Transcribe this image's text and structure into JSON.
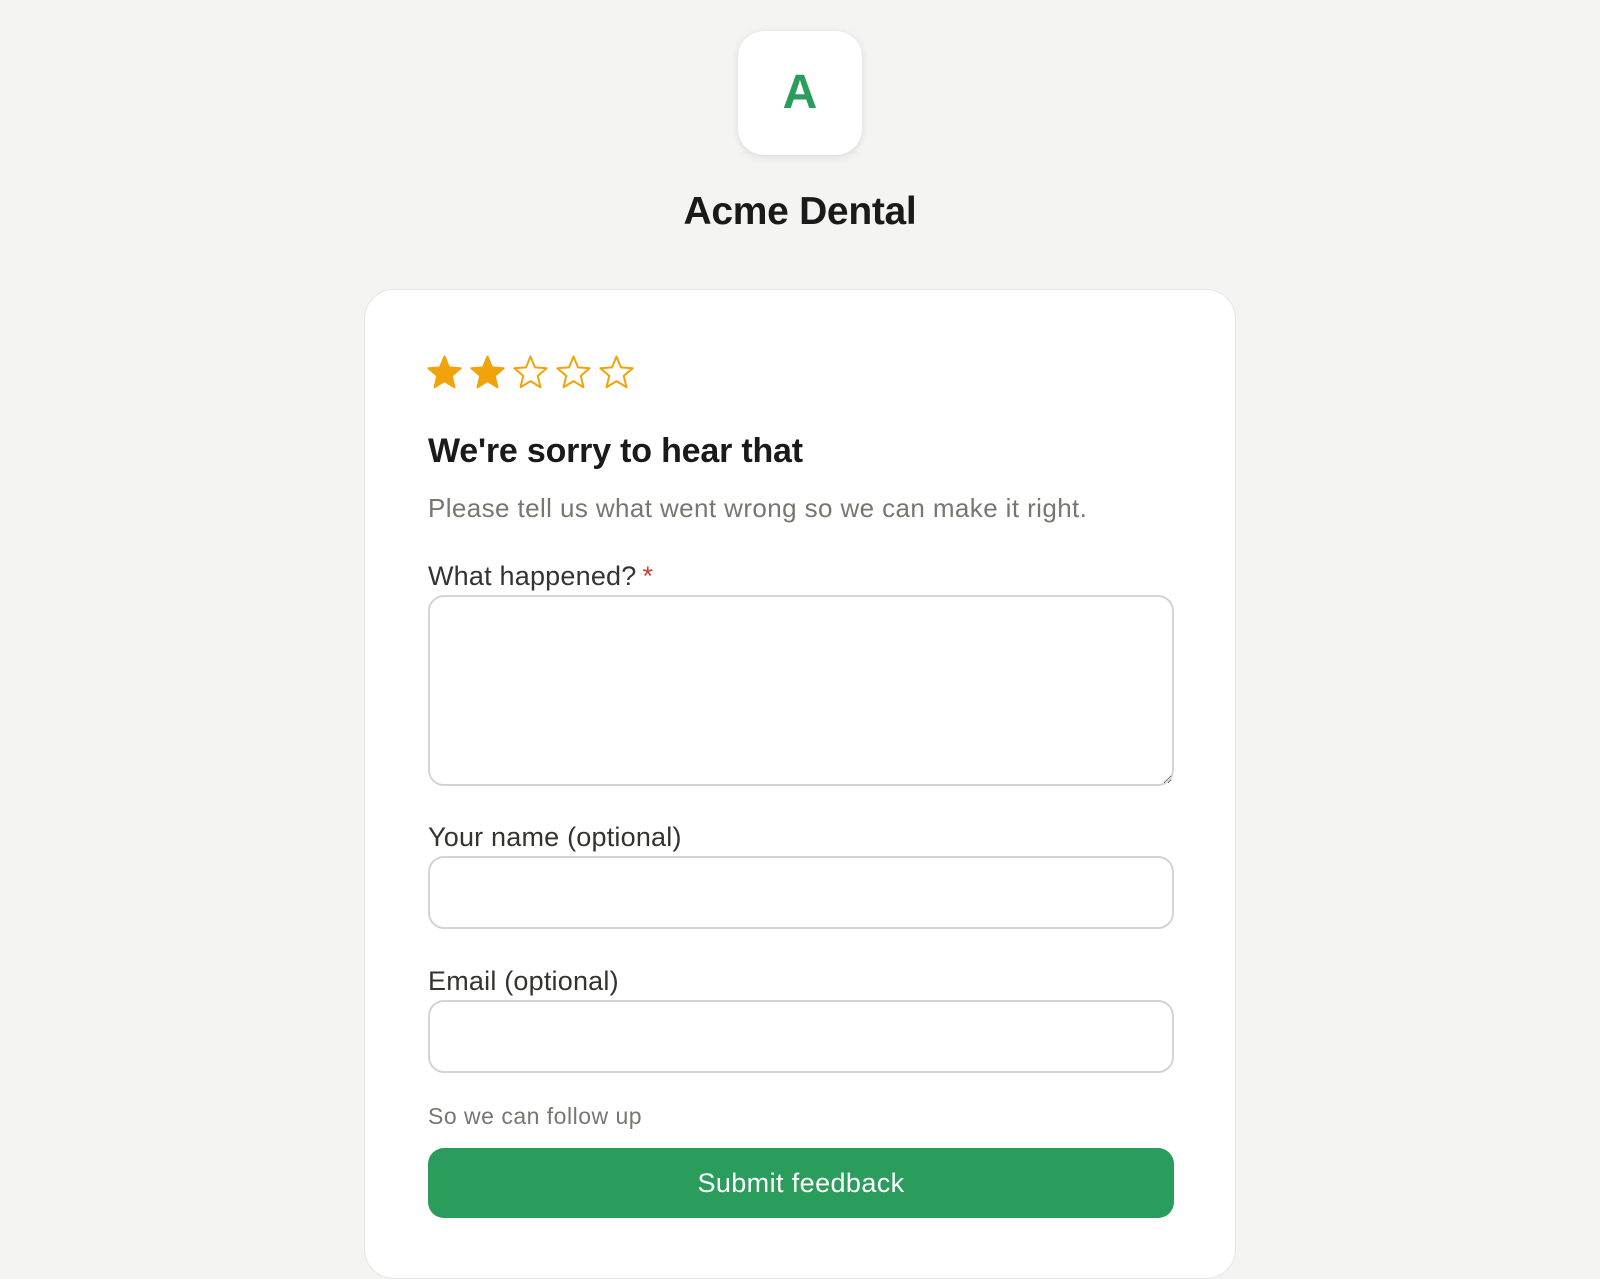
{
  "brand": {
    "logo_letter": "A",
    "name": "Acme Dental",
    "accent_color": "#2a9d5c"
  },
  "rating": {
    "value": 2,
    "max": 5,
    "filled_color": "#f0a30a",
    "icon": "star-icon"
  },
  "feedback": {
    "heading": "We're sorry to hear that",
    "subtext": "Please tell us what went wrong so we can make it right.",
    "what_happened": {
      "label": "What happened?",
      "required_mark": "*",
      "value": ""
    },
    "name_field": {
      "label": "Your name (optional)",
      "value": ""
    },
    "email_field": {
      "label": "Email (optional)",
      "value": "",
      "hint": "So we can follow up"
    },
    "submit_label": "Submit feedback"
  }
}
